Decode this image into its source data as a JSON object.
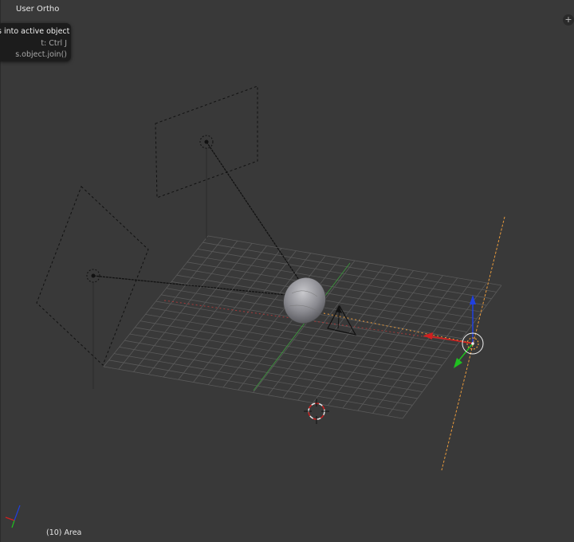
{
  "viewport": {
    "view_label": "User Ortho",
    "frame_label": "(10) Area",
    "corner_button_icon": "plus-icon"
  },
  "tooltip": {
    "title": "s into active object",
    "shortcut": "t: Ctrl J",
    "python": "s.object.join()"
  },
  "colors": {
    "background": "#393939",
    "grid": "#5a5a5a",
    "x_axis": "#a33a3a",
    "y_axis": "#3e8e3e",
    "selected_orange": "#e89a3c",
    "gizmo_red": "#d02020",
    "gizmo_green": "#20c020",
    "gizmo_blue": "#2040e0"
  }
}
